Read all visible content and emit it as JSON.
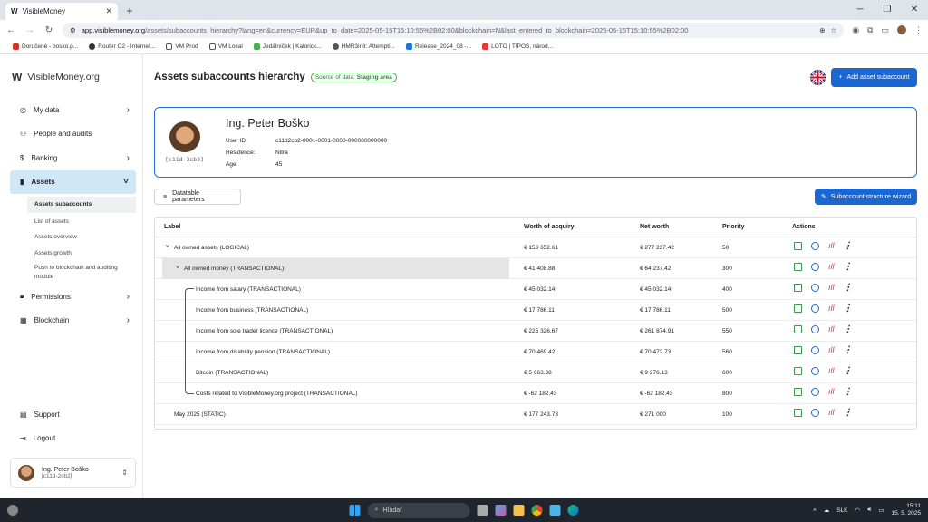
{
  "browser": {
    "tab_title": "VisibleMoney",
    "url_domain": "app.visiblemoney.org",
    "url_path": "/assets/subaccounts_hierarchy?lang=en&currency=EUR&up_to_date=2025-05-15T15:10:55%2B02:00&blockchain=N&last_entered_to_blockchain=2025-05-15T15:10:55%2B02:00",
    "bookmarks": [
      "Doručené - bosko.p...",
      "Router O2 - Internet...",
      "VM Prod",
      "VM Local",
      "Jedálníček | Kalorick...",
      "HMR3init: Attempti...",
      "Release_2024_08 -...",
      "LOTO | TIPOS, národ..."
    ]
  },
  "sidebar": {
    "brand": "VisibleMoney.org",
    "items": [
      {
        "label": "My data",
        "icon": "person-icon"
      },
      {
        "label": "People and audits",
        "icon": "people-icon"
      },
      {
        "label": "Banking",
        "icon": "bank-icon"
      },
      {
        "label": "Assets",
        "icon": "chart-icon"
      }
    ],
    "subitems": [
      "Assets subaccounts",
      "List of assets",
      "Assets overview",
      "Assets growth",
      "Push to blockchain and auditing module"
    ],
    "items2": [
      {
        "label": "Permissions",
        "icon": "lock-icon"
      },
      {
        "label": "Blockchain",
        "icon": "blockchain-icon"
      }
    ],
    "support": "Support",
    "logout": "Logout",
    "user_name": "Ing. Peter Boško",
    "user_id": "[c11d-2cb2]"
  },
  "page": {
    "title": "Assets subaccounts hierarchy",
    "source_prefix": "Source of data:",
    "source_value": "Staging area",
    "add_button": "Add asset subaccount",
    "datatable_button": "Datatable parameters",
    "wizard_button": "Subaccount structure wizard"
  },
  "profile": {
    "name": "Ing. Peter Boško",
    "avatar_id": "[c11d-2cb2]",
    "user_id_label": "User ID:",
    "user_id": "c11d2cb2-0001-0001-0000-000000000000",
    "residence_label": "Residence:",
    "residence": "Nitra",
    "age_label": "Age:",
    "age": "45"
  },
  "table": {
    "headers": [
      "Label",
      "Worth of acquiry",
      "Net worth",
      "Priority",
      "Actions"
    ],
    "rows": [
      {
        "label": "All owned assets (LOGICAL)",
        "worth": "€ 158 652.61",
        "net": "€ 277 237.42",
        "priority": "50",
        "level": 1,
        "caret": "˅"
      },
      {
        "label": "All owned money (TRANSACTIONAL)",
        "worth": "€ 41 408.88",
        "net": "€ 64 237.42",
        "priority": "300",
        "level": 2,
        "caret": "˅"
      },
      {
        "label": "Income from salary (TRANSACTIONAL)",
        "worth": "€ 45 032.14",
        "net": "€ 45 032.14",
        "priority": "400",
        "level": 3,
        "caret": ""
      },
      {
        "label": "Income from business (TRANSACTIONAL)",
        "worth": "€ 17 786.11",
        "net": "€ 17 786.11",
        "priority": "500",
        "level": 3,
        "caret": ""
      },
      {
        "label": "Income from sole trader licence (TRANSACTIONAL)",
        "worth": "€ 225 326.67",
        "net": "€ 261 874.91",
        "priority": "550",
        "level": 3,
        "caret": ""
      },
      {
        "label": "Income from disability pension (TRANSACTIONAL)",
        "worth": "€ 70 469.42",
        "net": "€ 70 472.73",
        "priority": "560",
        "level": 3,
        "caret": ""
      },
      {
        "label": "Bitcoin (TRANSACTIONAL)",
        "worth": "€ 5 663.38",
        "net": "€ 9 276.13",
        "priority": "600",
        "level": 3,
        "caret": ""
      },
      {
        "label": "Costs related to VisibleMoney.org project (TRANSACTIONAL)",
        "worth": "€ -62 182.43",
        "net": "€ -62 182.43",
        "priority": "800",
        "level": 3,
        "caret": ""
      },
      {
        "label": "May 2025 (STATIC)",
        "worth": "€ 177 243.73",
        "net": "€ 271 000",
        "priority": "100",
        "level": 1,
        "caret": ""
      }
    ]
  },
  "taskbar": {
    "search": "Hľadať",
    "lang": "SLK",
    "time": "15:11",
    "date": "15. 5. 2025"
  },
  "colors": {
    "primary": "#1a66d2",
    "active_nav": "#cfe7f7",
    "profile_border": "#1e74d6",
    "source_badge": "#2e7d32"
  }
}
